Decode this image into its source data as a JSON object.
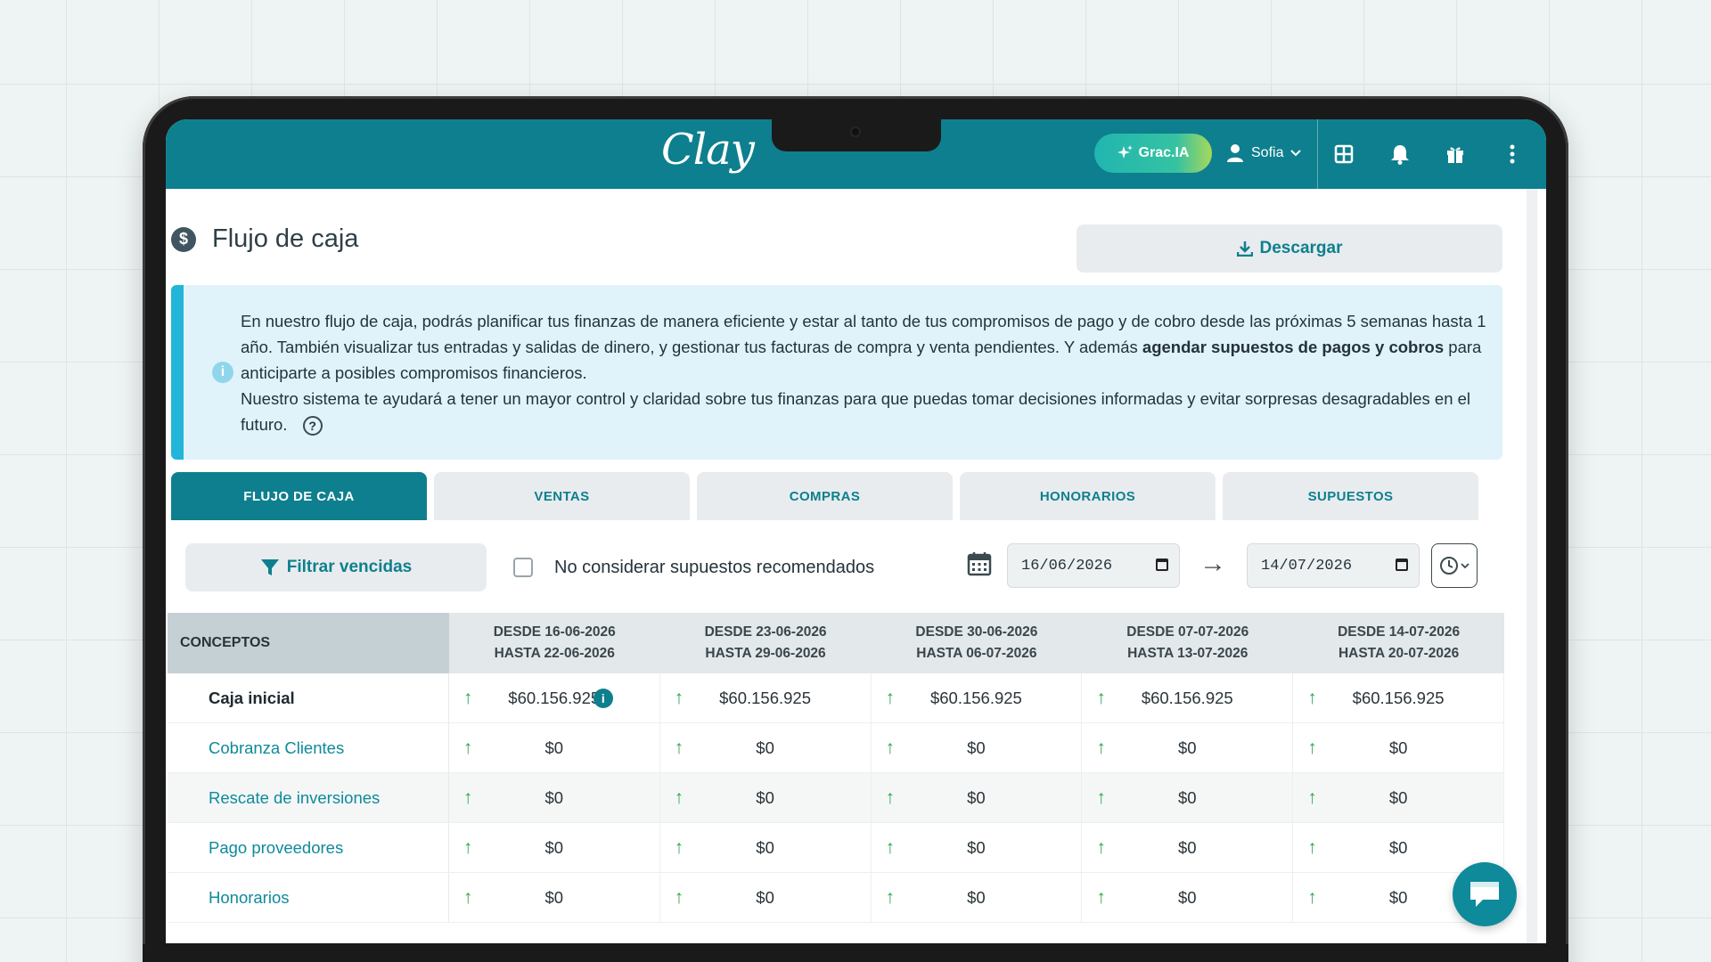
{
  "app": {
    "logo": "Clay",
    "assistant_label": "Grac.IA",
    "user_name": "Sofia"
  },
  "page": {
    "title": "Flujo de caja",
    "download_label": "Descargar"
  },
  "info": {
    "line1": "En nuestro flujo de caja, podrás planificar tus finanzas de manera eficiente y estar al tanto de tus compromisos de pago y de cobro desde las próximas 5 semanas hasta 1 año. También visualizar tus entradas y salidas de dinero, y gestionar tus facturas de compra y venta pendientes. Y además ",
    "bold": "agendar supuestos de pagos y cobros",
    "line1_end": " para anticiparte a posibles compromisos financieros.",
    "line2": "Nuestro sistema te ayudará a tener un mayor control y claridad sobre tus finanzas para que puedas tomar decisiones informadas y evitar sorpresas desagradables en el futuro."
  },
  "tabs": [
    "FLUJO DE CAJA",
    "VENTAS",
    "COMPRAS",
    "HONORARIOS",
    "SUPUESTOS"
  ],
  "filters": {
    "filter_label": "Filtrar vencidas",
    "checkbox_label": "No considerar supuestos recomendados",
    "date_from": "16/06/2026",
    "date_to": "14/07/2026"
  },
  "table": {
    "concept_header": "CONCEPTOS",
    "columns": [
      {
        "from": "DESDE 16-06-2026",
        "to": "HASTA 22-06-2026"
      },
      {
        "from": "DESDE 23-06-2026",
        "to": "HASTA 29-06-2026"
      },
      {
        "from": "DESDE 30-06-2026",
        "to": "HASTA 06-07-2026"
      },
      {
        "from": "DESDE 07-07-2026",
        "to": "HASTA 13-07-2026"
      },
      {
        "from": "DESDE 14-07-2026",
        "to": "HASTA 20-07-2026"
      }
    ],
    "rows": [
      {
        "concept": "Caja inicial",
        "values": [
          "$60.156.925",
          "$60.156.925",
          "$60.156.925",
          "$60.156.925",
          "$60.156.925"
        ]
      },
      {
        "concept": "Cobranza Clientes",
        "values": [
          "$0",
          "$0",
          "$0",
          "$0",
          "$0"
        ]
      },
      {
        "concept": "Rescate de inversiones",
        "values": [
          "$0",
          "$0",
          "$0",
          "$0",
          "$0"
        ]
      },
      {
        "concept": "Pago proveedores",
        "values": [
          "$0",
          "$0",
          "$0",
          "$0",
          "$0"
        ]
      },
      {
        "concept": "Honorarios",
        "values": [
          "$0",
          "$0",
          "$0",
          "$0",
          "$0"
        ]
      }
    ]
  },
  "colors": {
    "brand": "#0e7f8e",
    "up_arrow": "#2ea84f",
    "info_accent": "#22b5d9"
  },
  "icons": [
    "sparkle-icon",
    "user-icon",
    "chevron-down-icon",
    "grid-icon",
    "bell-icon",
    "gift-icon",
    "more-vertical-icon",
    "dollar-circle-icon",
    "download-icon",
    "info-icon",
    "help-icon",
    "filter-icon",
    "calendar-icon",
    "arrow-right-icon",
    "clock-icon",
    "arrow-up-icon",
    "chat-icon"
  ]
}
